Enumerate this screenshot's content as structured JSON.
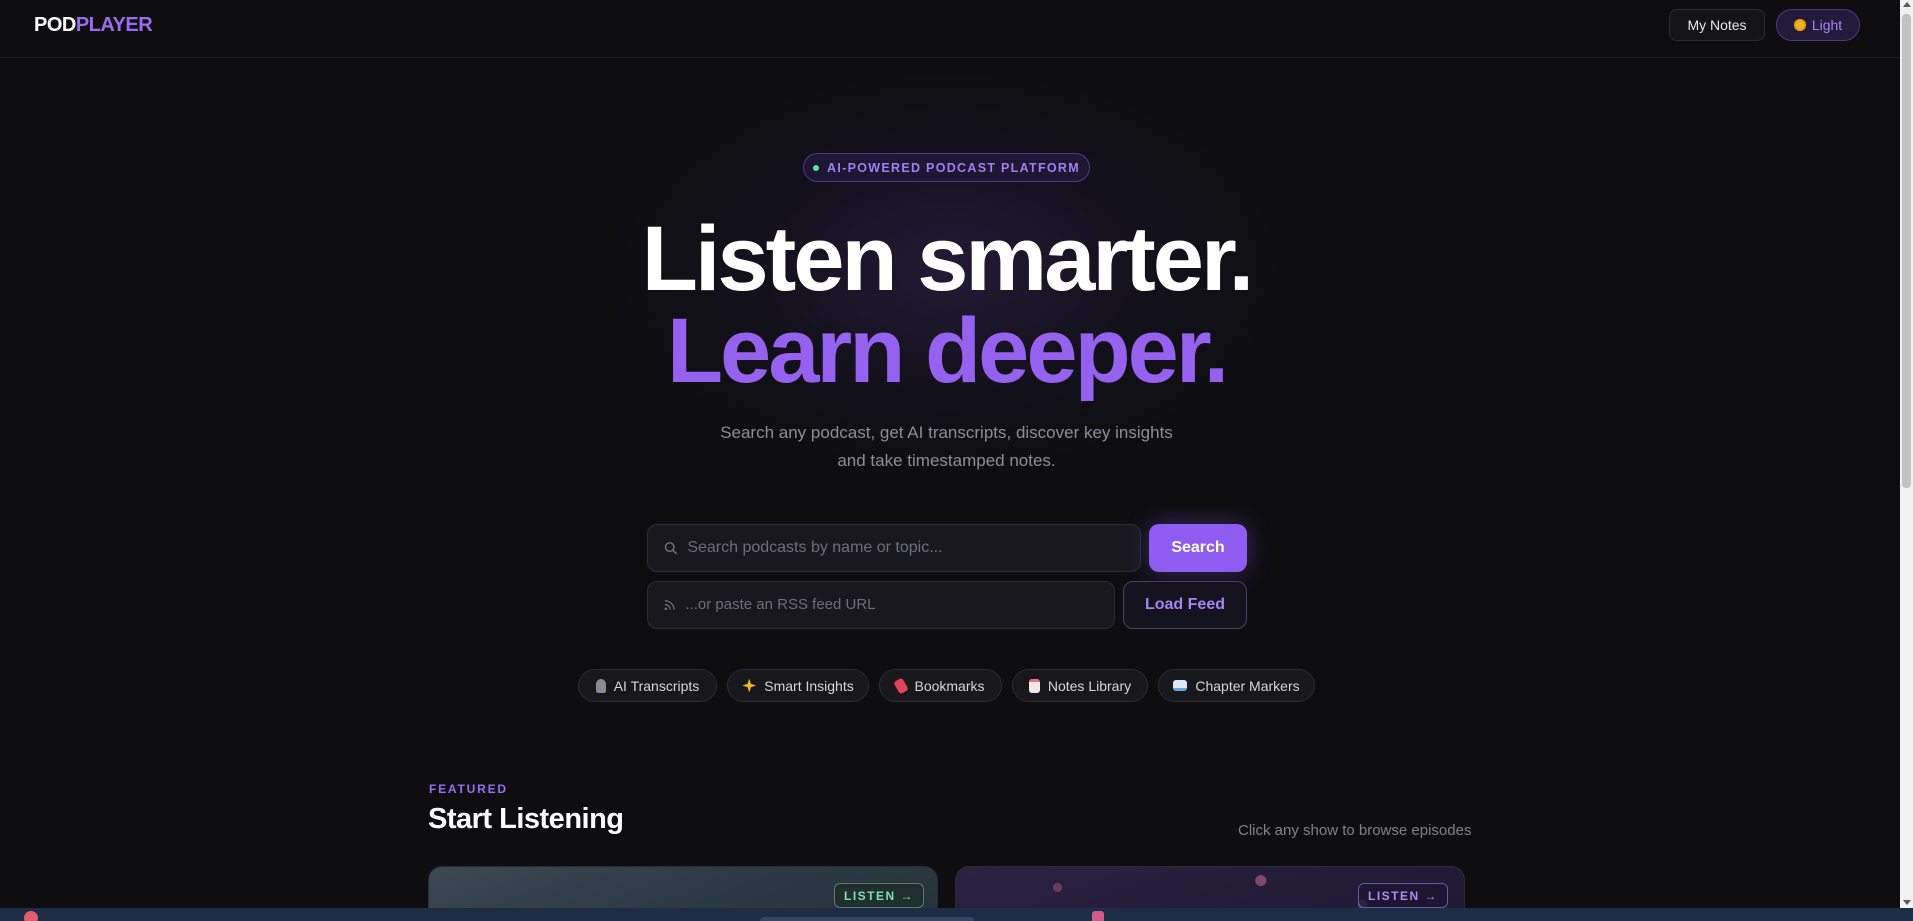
{
  "header": {
    "logo_part1": "POD",
    "logo_part2": "PLAYER",
    "notes_label": "My Notes",
    "theme_label": "Light"
  },
  "hero": {
    "badge": "AI-POWERED PODCAST PLATFORM",
    "title_line1": "Listen smarter.",
    "title_line2": "Learn deeper.",
    "subtitle_line1": "Search any podcast, get AI transcripts, discover key insights",
    "subtitle_line2": "and take timestamped notes."
  },
  "search": {
    "placeholder": "Search podcasts by name or topic...",
    "button": "Search",
    "rss_placeholder": "...or paste an RSS feed URL",
    "rss_button": "Load Feed"
  },
  "features": [
    {
      "label": "AI Transcripts",
      "icon": "microphone-icon",
      "color": "#8a8a96"
    },
    {
      "label": "Smart Insights",
      "icon": "sparkles-icon",
      "color": "#f1b622"
    },
    {
      "label": "Bookmarks",
      "icon": "bookmark-icon",
      "color": "#e0445a"
    },
    {
      "label": "Notes Library",
      "icon": "notepad-icon",
      "color": "#e07a8a"
    },
    {
      "label": "Chapter Markers",
      "icon": "book-icon",
      "color": "#6aa4e0"
    }
  ],
  "featured": {
    "kicker": "FEATURED",
    "title": "Start Listening",
    "hint": "Click any show to browse episodes",
    "cards": [
      {
        "listen_label": "LISTEN →"
      },
      {
        "listen_label": "LISTEN →"
      }
    ]
  },
  "colors": {
    "accent": "#8e5cf0",
    "background": "#0e0e11"
  }
}
